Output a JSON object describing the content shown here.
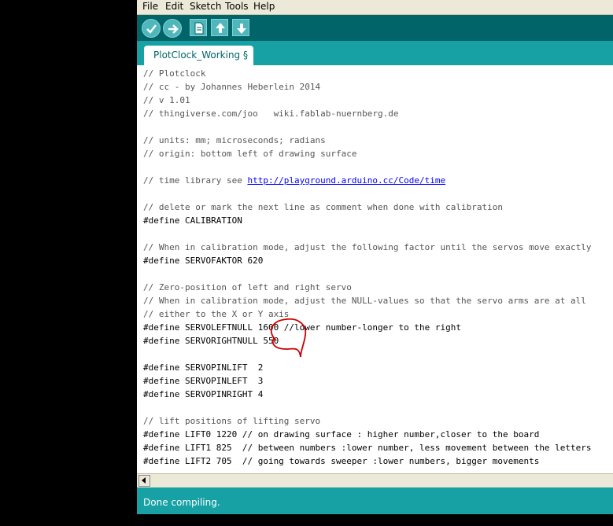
{
  "menu": [
    "File",
    "Edit",
    "Sketch",
    "Tools",
    "Help"
  ],
  "toolbar": {
    "buttons": [
      {
        "name": "verify-button",
        "icon": "checkmark-icon"
      },
      {
        "name": "upload-button",
        "icon": "arrow-right-icon"
      },
      {
        "name": "new-button",
        "icon": "new-file-icon"
      },
      {
        "name": "open-button",
        "icon": "arrow-up-icon"
      },
      {
        "name": "save-button",
        "icon": "arrow-down-icon"
      }
    ]
  },
  "tab": {
    "label": "PlotClock_Working §"
  },
  "code_lines": [
    "// Plotclock",
    "// cc - by Johannes Heberlein 2014",
    "// v 1.01",
    "// thingiverse.com/joo   wiki.fablab-nuernberg.de",
    "",
    "// units: mm; microseconds; radians",
    "// origin: bottom left of drawing surface",
    "",
    "// time library see ",
    "",
    "// delete or mark the next line as comment when done with calibration",
    "#define CALIBRATION",
    "",
    "// When in calibration mode, adjust the following factor until the servos move exactly",
    "#define SERVOFAKTOR 620",
    "",
    "// Zero-position of left and right servo",
    "// When in calibration mode, adjust the NULL-values so that the servo arms are at all",
    "// either to the X or Y axis",
    "#define SERVOLEFTNULL 1600 //lower number-longer to the right",
    "#define SERVORIGHTNULL 550",
    "",
    "#define SERVOPINLIFT  2",
    "#define SERVOPINLEFT  3",
    "#define SERVOPINRIGHT 4",
    "",
    "// lift positions of lifting servo",
    "#define LIFT0 1220 // on drawing surface : higher number,closer to the board",
    "#define LIFT1 825  // between numbers :lower number, less movement between the letters",
    "#define LIFT2 705  // going towards sweeper :lower numbers, bigger movements"
  ],
  "time_library_url": "http://playground.arduino.cc/Code/time",
  "status": "Done compiling.",
  "colors": {
    "toolbar": "#006468",
    "tabbar": "#17a1a5",
    "button": "#4db7bb",
    "annotation": "#cc0000"
  }
}
